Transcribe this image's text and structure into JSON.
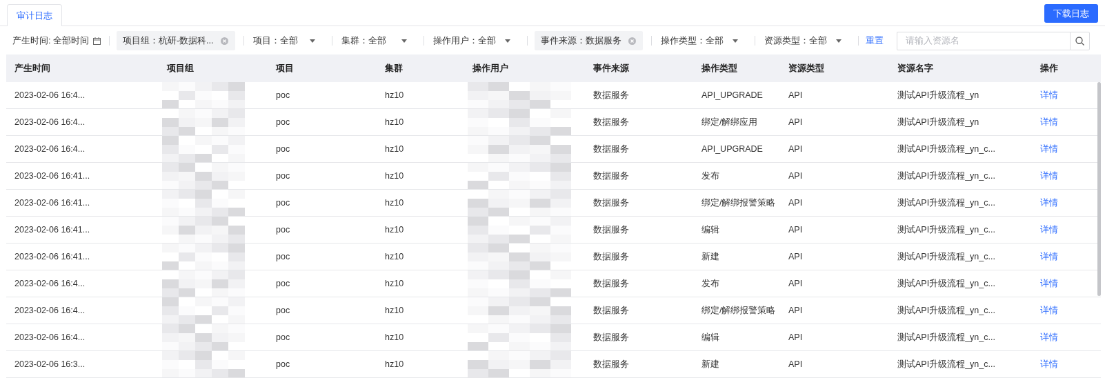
{
  "tabs": [
    {
      "label": "审计日志",
      "selected": true
    }
  ],
  "download_button": "下载日志",
  "filters": [
    {
      "kind": "date",
      "text": "产生时间: 全部时间"
    },
    {
      "kind": "tag",
      "text": "项目组：杭研-数据科..."
    },
    {
      "kind": "select",
      "text": "项目：全部"
    },
    {
      "kind": "select",
      "text": "集群：全部"
    },
    {
      "kind": "select",
      "text": "操作用户：全部"
    },
    {
      "kind": "tag",
      "text": "事件来源：数据服务"
    },
    {
      "kind": "select",
      "text": "操作类型：全部"
    },
    {
      "kind": "select",
      "text": "资源类型：全部"
    }
  ],
  "reset_link": "重置",
  "search": {
    "placeholder": "请输入资源名"
  },
  "table": {
    "columns": [
      "产生时间",
      "项目组",
      "项目",
      "集群",
      "操作用户",
      "事件来源",
      "操作类型",
      "资源类型",
      "资源名字",
      "操作"
    ],
    "rows": [
      {
        "time": "2023-02-06 16:4...",
        "project": "poc",
        "cluster": "hz10",
        "event_source": "数据服务",
        "operation_type": "API_UPGRADE",
        "resource_type": "API",
        "resource_name": "测试API升级流程_yn",
        "action": "详情"
      },
      {
        "time": "2023-02-06 16:4...",
        "project": "poc",
        "cluster": "hz10",
        "event_source": "数据服务",
        "operation_type": "绑定/解绑应用",
        "resource_type": "API",
        "resource_name": "测试API升级流程_yn",
        "action": "详情"
      },
      {
        "time": "2023-02-06 16:4...",
        "project": "poc",
        "cluster": "hz10",
        "event_source": "数据服务",
        "operation_type": "API_UPGRADE",
        "resource_type": "API",
        "resource_name": "测试API升级流程_yn_c...",
        "action": "详情"
      },
      {
        "time": "2023-02-06 16:41...",
        "project": "poc",
        "cluster": "hz10",
        "event_source": "数据服务",
        "operation_type": "发布",
        "resource_type": "API",
        "resource_name": "测试API升级流程_yn_c...",
        "action": "详情"
      },
      {
        "time": "2023-02-06 16:41...",
        "project": "poc",
        "cluster": "hz10",
        "event_source": "数据服务",
        "operation_type": "绑定/解绑报警策略",
        "resource_type": "API",
        "resource_name": "测试API升级流程_yn_c...",
        "action": "详情"
      },
      {
        "time": "2023-02-06 16:41...",
        "project": "poc",
        "cluster": "hz10",
        "event_source": "数据服务",
        "operation_type": "编辑",
        "resource_type": "API",
        "resource_name": "测试API升级流程_yn_c...",
        "action": "详情"
      },
      {
        "time": "2023-02-06 16:41...",
        "project": "poc",
        "cluster": "hz10",
        "event_source": "数据服务",
        "operation_type": "新建",
        "resource_type": "API",
        "resource_name": "测试API升级流程_yn_c...",
        "action": "详情"
      },
      {
        "time": "2023-02-06 16:4...",
        "project": "poc",
        "cluster": "hz10",
        "event_source": "数据服务",
        "operation_type": "发布",
        "resource_type": "API",
        "resource_name": "测试API升级流程_yn_c...",
        "action": "详情"
      },
      {
        "time": "2023-02-06 16:4...",
        "project": "poc",
        "cluster": "hz10",
        "event_source": "数据服务",
        "operation_type": "绑定/解绑报警策略",
        "resource_type": "API",
        "resource_name": "测试API升级流程_yn_c...",
        "action": "详情"
      },
      {
        "time": "2023-02-06 16:4...",
        "project": "poc",
        "cluster": "hz10",
        "event_source": "数据服务",
        "operation_type": "编辑",
        "resource_type": "API",
        "resource_name": "测试API升级流程_yn_c...",
        "action": "详情"
      },
      {
        "time": "2023-02-06 16:3...",
        "project": "poc",
        "cluster": "hz10",
        "event_source": "数据服务",
        "operation_type": "新建",
        "resource_type": "API",
        "resource_name": "测试API升级流程_yn_c...",
        "action": "详情"
      }
    ]
  }
}
